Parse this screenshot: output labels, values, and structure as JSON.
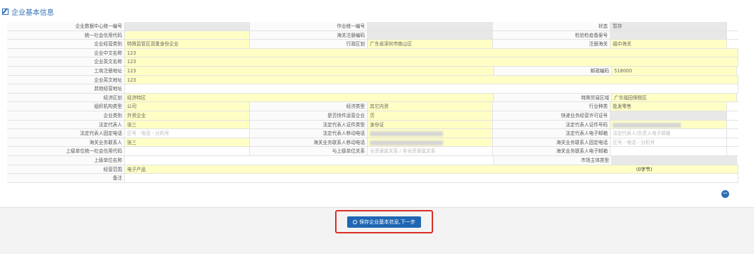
{
  "section_title": "企业基本信息",
  "rows": [
    [
      {
        "l": "企业数据中心统一编号",
        "v": "",
        "t": "gray"
      },
      {
        "l": "作业统一编号",
        "v": "",
        "t": "gray"
      },
      {
        "l": "状态",
        "v": "暂存",
        "t": "gray"
      }
    ],
    [
      {
        "l": "统一社会信用代码",
        "v": "",
        "t": "yellow"
      },
      {
        "l": "海关注册编码",
        "v": "",
        "t": "gray"
      },
      {
        "l": "检验检疫备案号",
        "v": "",
        "t": "gray"
      }
    ],
    [
      {
        "l": "企业经营类别",
        "v": "特殊监管区双重身份企业",
        "t": "yellow"
      },
      {
        "l": "行政区划",
        "v": "广东省深圳市南山区",
        "t": "yellow"
      },
      {
        "l": "注册海关",
        "v": "福中海关",
        "t": "yellow"
      }
    ],
    [
      {
        "l": "企业中文名称",
        "v": "123",
        "t": "yellow",
        "wide": true
      }
    ],
    [
      {
        "l": "企业英文名称",
        "v": "123",
        "t": "yellow",
        "wide": true
      }
    ],
    [
      {
        "l": "工商注册地址",
        "v": "123",
        "t": "yellow",
        "span2": true
      },
      {
        "l": "邮政编码",
        "v": "518000",
        "t": "yellow"
      }
    ],
    [
      {
        "l": "企业英文地址",
        "v": "123",
        "t": "yellow",
        "wide": true
      }
    ],
    [
      {
        "l": "其他经营地址",
        "v": "",
        "t": "white",
        "wide": true
      }
    ],
    [
      {
        "l": "经济区划",
        "v": "经济特区",
        "t": "yellow",
        "span2": true
      },
      {
        "l": "特殊贸易区域",
        "v": "广东福田保税区",
        "t": "yellow"
      }
    ],
    [
      {
        "l": "组织机构类型",
        "v": "公司",
        "t": "yellow"
      },
      {
        "l": "经济类型",
        "v": "其它内资",
        "t": "yellow"
      },
      {
        "l": "行业种类",
        "v": "批发零售",
        "t": "yellow"
      }
    ],
    [
      {
        "l": "企业类别",
        "v": "外资企业",
        "t": "yellow"
      },
      {
        "l": "是否快件运营企业",
        "v": "否",
        "t": "yellow"
      },
      {
        "l": "快递业务经营许可证号",
        "v": "",
        "t": "gray"
      }
    ],
    [
      {
        "l": "法定代表人",
        "v": "张三",
        "t": "yellow"
      },
      {
        "l": "法定代表人证件类型",
        "v": "身份证",
        "t": "yellow"
      },
      {
        "l": "法定代表人证件号码",
        "v": "",
        "t": "yellow",
        "blur": true
      }
    ],
    [
      {
        "l": "法定代表人固定电话",
        "v": "区号 - 电话 - 分机号",
        "t": "white",
        "ph": true
      },
      {
        "l": "法定代表人移动电话",
        "v": "",
        "t": "yellow",
        "blur": true
      },
      {
        "l": "法定代表人电子邮箱",
        "v": "法定代表人/负责人电子邮箱",
        "t": "white",
        "ph": true
      }
    ],
    [
      {
        "l": "海关业务联系人",
        "v": "张三",
        "t": "yellow"
      },
      {
        "l": "海关业务联系人移动电话",
        "v": "",
        "t": "yellow",
        "blur": true
      },
      {
        "l": "海关业务联系人固定电话",
        "v": "区号 - 电话 - 分机号",
        "t": "white",
        "ph": true
      }
    ],
    [
      {
        "l": "上级单位统一社会信用代码",
        "v": "",
        "t": "white"
      },
      {
        "l": "与上级单位关系",
        "v": "全资隶属关系 / 非全资隶属关系",
        "t": "white",
        "ph": true
      },
      {
        "l": "海关业务联系人电子邮箱",
        "v": "",
        "t": "white"
      }
    ],
    [
      {
        "l": "上级单位名称",
        "v": "",
        "t": "white",
        "span2": true
      },
      {
        "l": "市场主体类型",
        "v": "",
        "t": "gray"
      }
    ],
    [
      {
        "l": "经营范围",
        "v": "电子产品",
        "t": "yellow",
        "wide": true,
        "suffix": "(0字节)"
      }
    ],
    [
      {
        "l": "备注",
        "v": "",
        "t": "white",
        "wide": true
      }
    ]
  ],
  "save_label": "保存企业基本信息,下一步",
  "minus_label": "−"
}
